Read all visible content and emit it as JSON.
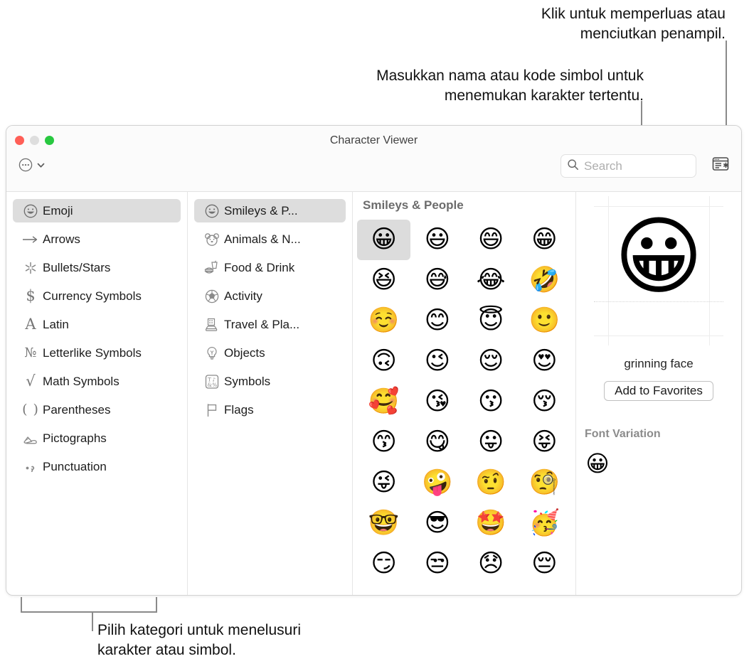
{
  "annotations": {
    "collapse_note": "Klik untuk memperluas atau\nmenciutkan penampil.",
    "search_note": "Masukkan nama atau kode simbol untuk\nmenemukan karakter tertentu.",
    "categories_note": "Pilih kategori untuk menelusuri\nkarakter atau simbol."
  },
  "window": {
    "title": "Character Viewer",
    "traffic_lights": [
      "close",
      "minimize",
      "zoom"
    ]
  },
  "toolbar": {
    "menu_icon": "circle-ellipsis-icon",
    "menu_chevron_icon": "chevron-down-icon",
    "search": {
      "icon": "search-icon",
      "placeholder": "Search",
      "value": ""
    },
    "collapse_icon": "collapse-viewer-icon"
  },
  "categories": {
    "selected": "Emoji",
    "items": [
      {
        "label": "Emoji",
        "icon": "smiley-face-icon",
        "glyph": "☺",
        "selected": true
      },
      {
        "label": "Arrows",
        "icon": "arrow-right-icon",
        "glyph": "⟶",
        "selected": false
      },
      {
        "label": "Bullets/Stars",
        "icon": "asterisk-star-icon",
        "glyph": "✳",
        "selected": false
      },
      {
        "label": "Currency Symbols",
        "icon": "dollar-sign-icon",
        "glyph": "$",
        "selected": false
      },
      {
        "label": "Latin",
        "icon": "letter-a-icon",
        "glyph": "A",
        "selected": false
      },
      {
        "label": "Letterlike Symbols",
        "icon": "numero-sign-icon",
        "glyph": "№",
        "selected": false
      },
      {
        "label": "Math Symbols",
        "icon": "square-root-icon",
        "glyph": "√",
        "selected": false
      },
      {
        "label": "Parentheses",
        "icon": "parentheses-icon",
        "glyph": "( )",
        "selected": false
      },
      {
        "label": "Pictographs",
        "icon": "writing-hand-icon",
        "glyph": "✍",
        "selected": false
      },
      {
        "label": "Punctuation",
        "icon": "period-comma-icon",
        "glyph": "·,",
        "selected": false
      }
    ]
  },
  "subcategories": {
    "selected": "Smileys & P...",
    "items": [
      {
        "label": "Smileys & P...",
        "icon": "smiley-face-icon",
        "glyph": "☺",
        "selected": true
      },
      {
        "label": "Animals & N...",
        "icon": "bear-face-icon",
        "glyph": "ὃB",
        "selected": false
      },
      {
        "label": "Food & Drink",
        "icon": "burger-drink-icon",
        "glyph": "ἵ4",
        "selected": false
      },
      {
        "label": "Activity",
        "icon": "soccer-ball-icon",
        "glyph": "⚽",
        "selected": false
      },
      {
        "label": "Travel & Pla...",
        "icon": "city-car-icon",
        "glyph": "Ὡ9",
        "selected": false
      },
      {
        "label": "Objects",
        "icon": "lightbulb-icon",
        "glyph": "Ὂ1",
        "selected": false
      },
      {
        "label": "Symbols",
        "icon": "symbols-grid-icon",
        "glyph": "&",
        "selected": false
      },
      {
        "label": "Flags",
        "icon": "flag-icon",
        "glyph": "⚑",
        "selected": false
      }
    ]
  },
  "grid": {
    "title": "Smileys & People",
    "selected_index": 0,
    "emojis": [
      {
        "char": "😀",
        "name": "grinning face"
      },
      {
        "char": "😃",
        "name": "grinning face with big eyes"
      },
      {
        "char": "😄",
        "name": "grinning face with smiling eyes"
      },
      {
        "char": "😁",
        "name": "beaming face with smiling eyes"
      },
      {
        "char": "😆",
        "name": "grinning squinting face"
      },
      {
        "char": "😅",
        "name": "grinning face with sweat"
      },
      {
        "char": "😂",
        "name": "face with tears of joy"
      },
      {
        "char": "🤣",
        "name": "rolling on the floor laughing"
      },
      {
        "char": "☺️",
        "name": "smiling face"
      },
      {
        "char": "😊",
        "name": "smiling face with smiling eyes"
      },
      {
        "char": "😇",
        "name": "smiling face with halo"
      },
      {
        "char": "🙂",
        "name": "slightly smiling face"
      },
      {
        "char": "🙃",
        "name": "upside-down face"
      },
      {
        "char": "😉",
        "name": "winking face"
      },
      {
        "char": "😌",
        "name": "relieved face"
      },
      {
        "char": "😍",
        "name": "smiling face with heart-eyes"
      },
      {
        "char": "🥰",
        "name": "smiling face with hearts"
      },
      {
        "char": "😘",
        "name": "face blowing a kiss"
      },
      {
        "char": "😗",
        "name": "kissing face"
      },
      {
        "char": "😚",
        "name": "kissing face with closed eyes"
      },
      {
        "char": "😙",
        "name": "kissing face with smiling eyes"
      },
      {
        "char": "😋",
        "name": "face savoring food"
      },
      {
        "char": "😛",
        "name": "face with tongue"
      },
      {
        "char": "😝",
        "name": "squinting face with tongue"
      },
      {
        "char": "😜",
        "name": "winking face with tongue"
      },
      {
        "char": "🤪",
        "name": "zany face"
      },
      {
        "char": "🤨",
        "name": "face with raised eyebrow"
      },
      {
        "char": "🧐",
        "name": "face with monocle"
      },
      {
        "char": "🤓",
        "name": "nerd face"
      },
      {
        "char": "😎",
        "name": "smiling face with sunglasses"
      },
      {
        "char": "🤩",
        "name": "star-struck"
      },
      {
        "char": "🥳",
        "name": "partying face"
      },
      {
        "char": "😏",
        "name": "smirking face"
      },
      {
        "char": "😒",
        "name": "unamused face"
      },
      {
        "char": "😞",
        "name": "disappointed face"
      },
      {
        "char": "😔",
        "name": "pensive face"
      }
    ]
  },
  "detail": {
    "preview_char": "😀",
    "character_name": "grinning face",
    "add_to_favorites_label": "Add to Favorites",
    "font_variation_label": "Font Variation",
    "variations": [
      {
        "char": "😀",
        "name": "grinning face"
      }
    ]
  },
  "colors": {
    "selection": "#dddddd",
    "window_border": "#d2d2d2",
    "titlebar": "#fbfbfb",
    "traffic_close": "#ff5f57",
    "traffic_min": "#dedede",
    "traffic_zoom": "#28c840",
    "leader_line": "#8a8a8a"
  }
}
